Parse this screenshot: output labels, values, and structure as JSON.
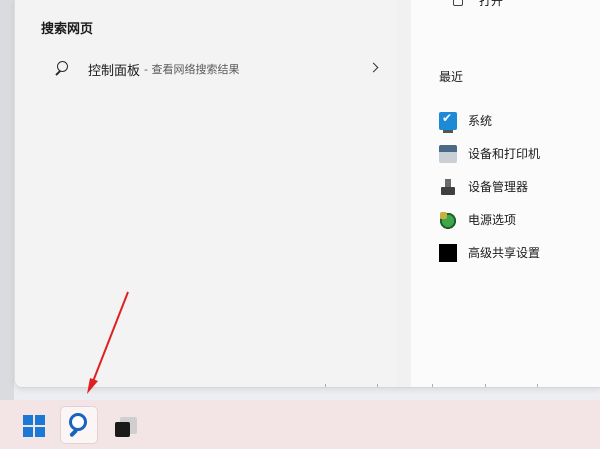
{
  "left_pane": {
    "section_title": "搜索网页",
    "result": {
      "title": "控制面板",
      "subtitle": "- 查看网络搜索结果"
    }
  },
  "right_pane": {
    "open_label": "打开",
    "recent_title": "最近",
    "recent_items": [
      {
        "label": "系统",
        "icon": "system-icon"
      },
      {
        "label": "设备和打印机",
        "icon": "printer-icon"
      },
      {
        "label": "设备管理器",
        "icon": "device-manager-icon"
      },
      {
        "label": "电源选项",
        "icon": "power-options-icon"
      },
      {
        "label": "高级共享设置",
        "icon": "sharing-settings-icon"
      }
    ]
  },
  "taskbar": {
    "items": [
      "start-button",
      "search-button",
      "task-view-button"
    ]
  },
  "colors": {
    "accent": "#1565c0",
    "windows_blue": "#1b78d6",
    "taskbar_bg": "#f3e4e6",
    "annotation_arrow": "#e02020"
  }
}
